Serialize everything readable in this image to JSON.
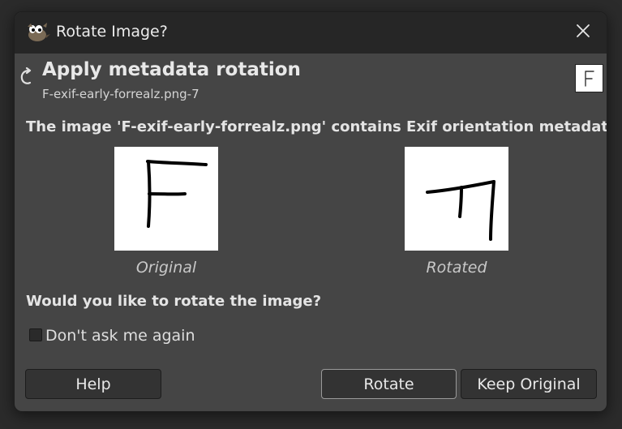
{
  "window": {
    "title": "Rotate Image?"
  },
  "header": {
    "title": "Apply metadata rotation",
    "subtitle": "F-exif-early-forrealz.png-7"
  },
  "body": {
    "info": "The image 'F-exif-early-forrealz.png' contains Exif orientation metadata",
    "original_caption": "Original",
    "rotated_caption": "Rotated",
    "question": "Would you like to rotate the image?",
    "dont_ask_label": "Don't ask me again",
    "dont_ask_checked": false
  },
  "buttons": {
    "help": "Help",
    "rotate": "Rotate",
    "keep_original": "Keep Original"
  },
  "icons": {
    "app": "wilber-icon",
    "close": "close-icon",
    "header": "rotate-arrow-icon"
  }
}
